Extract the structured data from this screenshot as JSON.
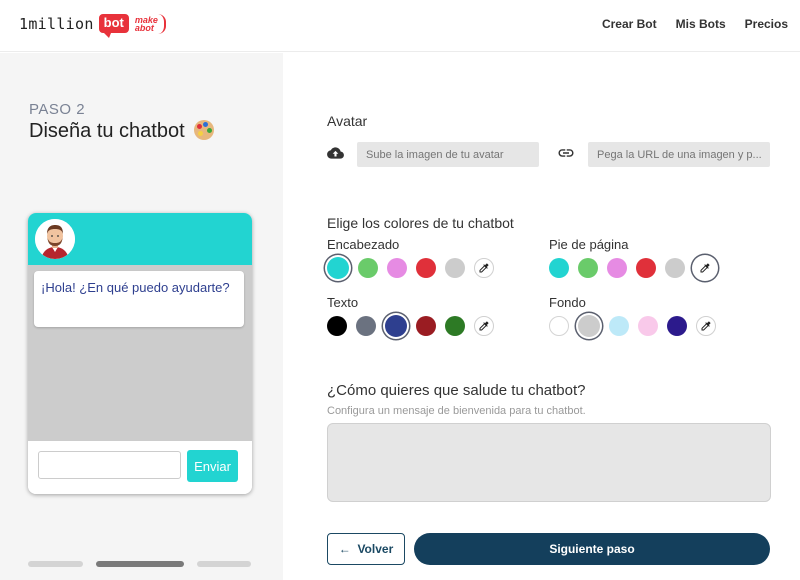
{
  "header": {
    "logo_text": "1million",
    "logo_badge": "bot",
    "logo_make_line1": "make",
    "logo_make_line2": "abot",
    "nav": [
      "Crear Bot",
      "Mis Bots",
      "Precios"
    ]
  },
  "left": {
    "step": "PASO 2",
    "title": "Diseña tu chatbot",
    "title_icon": "palette-icon",
    "preview": {
      "header_color": "#22d4d1",
      "body_color": "#cccccc",
      "bubble_text_color": "#2e3f8f",
      "greeting": "¡Hola! ¿En qué puedo ayudarte?",
      "send_label": "Enviar"
    },
    "progress": {
      "steps": 3,
      "current": 2
    }
  },
  "avatar_section": {
    "label": "Avatar",
    "upload_icon": "cloud-upload-icon",
    "upload_placeholder": "Sube la imagen de tu avatar",
    "link_icon": "link-icon",
    "url_placeholder": "Pega la URL de una imagen y p..."
  },
  "colors_section": {
    "label": "Elige los colores de tu chatbot",
    "groups": {
      "encabezado": {
        "label": "Encabezado",
        "colors": [
          "#22d4d1",
          "#6acb6a",
          "#e68be3",
          "#e0303a",
          "#cccccc"
        ],
        "selected": 0,
        "picker_icon": "eyedropper-icon"
      },
      "pie": {
        "label": "Pie de página",
        "colors": [
          "#22d4d1",
          "#6acb6a",
          "#e68be3",
          "#e0303a",
          "#cccccc"
        ],
        "selected": 5,
        "picker_icon": "eyedropper-icon"
      },
      "texto": {
        "label": "Texto",
        "colors": [
          "#000000",
          "#6b7280",
          "#2e3f8f",
          "#9a1c22",
          "#2d7a25"
        ],
        "selected": 2,
        "picker_icon": "eyedropper-icon"
      },
      "fondo": {
        "label": "Fondo",
        "colors": [
          "#ffffff",
          "#cccccc",
          "#bde9f8",
          "#f9c9ea",
          "#2c1a8c"
        ],
        "selected": 1,
        "picker_icon": "eyedropper-icon"
      }
    }
  },
  "greeting_section": {
    "title": "¿Cómo quieres que salude tu chatbot?",
    "subtitle": "Configura un mensaje de bienvenida para tu chatbot."
  },
  "actions": {
    "back_label": "Volver",
    "back_icon": "arrow-left-icon",
    "next_label": "Siguiente paso"
  }
}
